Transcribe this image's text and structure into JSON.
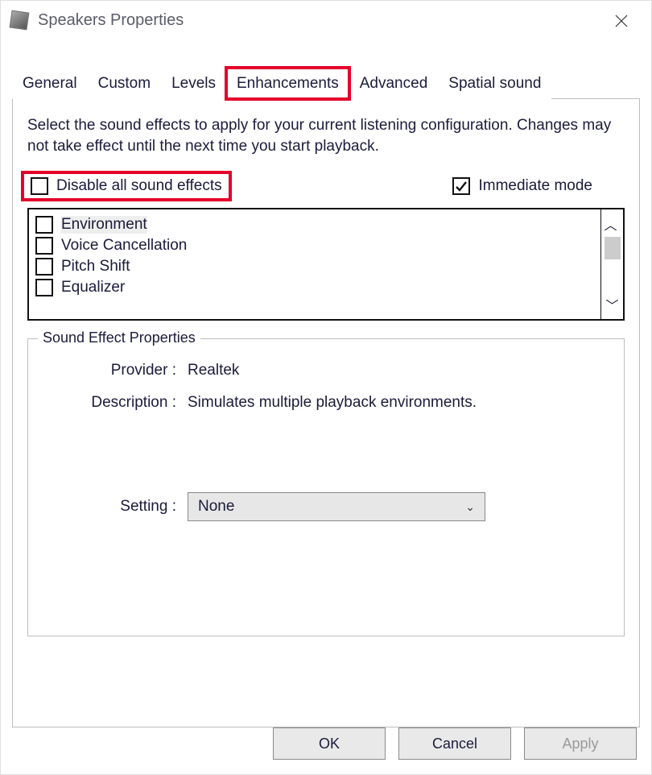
{
  "window": {
    "title": "Speakers Properties"
  },
  "tabs": {
    "items": [
      {
        "label": "General"
      },
      {
        "label": "Custom"
      },
      {
        "label": "Levels"
      },
      {
        "label": "Enhancements"
      },
      {
        "label": "Advanced"
      },
      {
        "label": "Spatial sound"
      }
    ],
    "active_index": 3,
    "highlighted_index": 3
  },
  "enhancements": {
    "instructions": "Select the sound effects to apply for your current listening configuration. Changes may not take effect until the next time you start playback.",
    "disable_all": {
      "label": "Disable all sound effects",
      "checked": false
    },
    "immediate_mode": {
      "label": "Immediate mode",
      "checked": true
    },
    "effects": [
      {
        "label": "Environment",
        "checked": false,
        "selected": true
      },
      {
        "label": "Voice Cancellation",
        "checked": false,
        "selected": false
      },
      {
        "label": "Pitch Shift",
        "checked": false,
        "selected": false
      },
      {
        "label": "Equalizer",
        "checked": false,
        "selected": false
      }
    ],
    "properties": {
      "legend": "Sound Effect Properties",
      "provider_label": "Provider :",
      "provider_value": "Realtek",
      "description_label": "Description :",
      "description_value": "Simulates multiple playback environments.",
      "setting_label": "Setting :",
      "setting_value": "None"
    }
  },
  "buttons": {
    "ok": "OK",
    "cancel": "Cancel",
    "apply": "Apply"
  },
  "colors": {
    "highlight": "#e4002b"
  }
}
